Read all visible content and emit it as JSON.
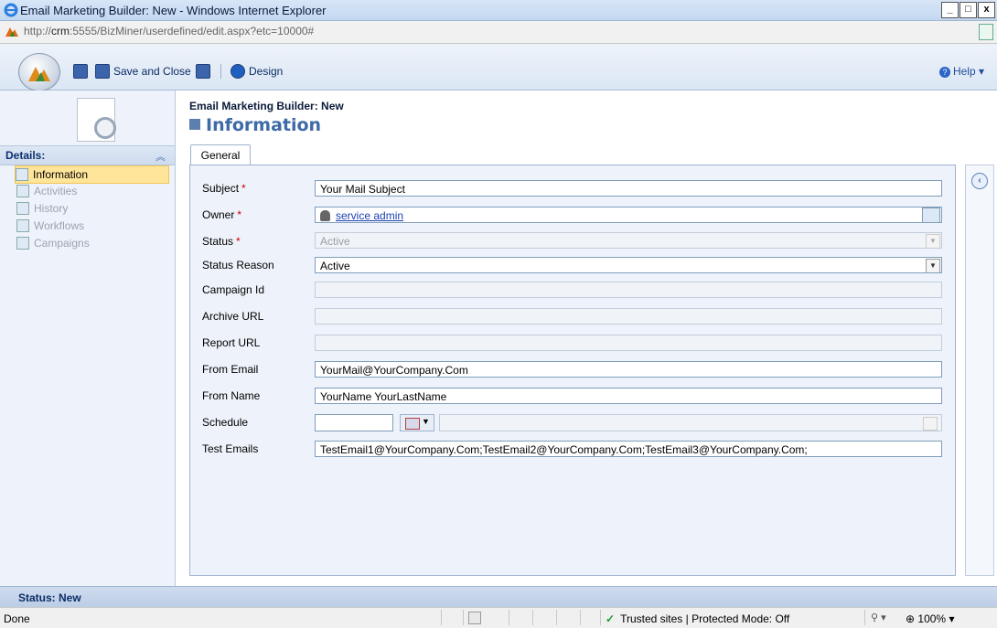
{
  "window": {
    "title": "Email Marketing Builder: New - Windows Internet Explorer",
    "buttons": [
      "_",
      "□",
      "x"
    ]
  },
  "address": {
    "url_prefix": "http://",
    "url_host": "crm",
    "url_rest": ":5555/BizMiner/userdefined/edit.aspx?etc=10000#"
  },
  "toolbar": {
    "save_close_label": "Save and Close",
    "design_label": "Design",
    "help_label": "Help"
  },
  "header": {
    "entity_title": "Email Marketing Builder: New",
    "section_title": "Information"
  },
  "nav": {
    "title": "Details:",
    "items": [
      {
        "label": "Information"
      },
      {
        "label": "Activities"
      },
      {
        "label": "History"
      },
      {
        "label": "Workflows"
      },
      {
        "label": "Campaigns"
      }
    ]
  },
  "tab": {
    "label": "General"
  },
  "form": {
    "subject": {
      "label": "Subject",
      "value": "Your Mail Subject"
    },
    "owner": {
      "label": "Owner",
      "value": "service admin"
    },
    "status": {
      "label": "Status",
      "value": "Active"
    },
    "status_reason": {
      "label": "Status Reason",
      "value": "Active"
    },
    "campaign_id": {
      "label": "Campaign Id",
      "value": ""
    },
    "archive_url": {
      "label": "Archive URL",
      "value": ""
    },
    "report_url": {
      "label": "Report URL",
      "value": ""
    },
    "from_email": {
      "label": "From Email",
      "value": "YourMail@YourCompany.Com"
    },
    "from_name": {
      "label": "From Name",
      "value": "YourName YourLastName"
    },
    "schedule": {
      "label": "Schedule",
      "value": ""
    },
    "test_emails": {
      "label": "Test Emails",
      "value": "TestEmail1@YourCompany.Com;TestEmail2@YourCompany.Com;TestEmail3@YourCompany.Com;"
    }
  },
  "status_band": {
    "text": "Status: New"
  },
  "ie_status": {
    "done": "Done",
    "zone": "Trusted sites | Protected Mode: Off",
    "zoom": "100%"
  },
  "colors": {
    "heading": "#3e6aa6",
    "required": "#d00000",
    "nav_active": "#ffe59a"
  }
}
